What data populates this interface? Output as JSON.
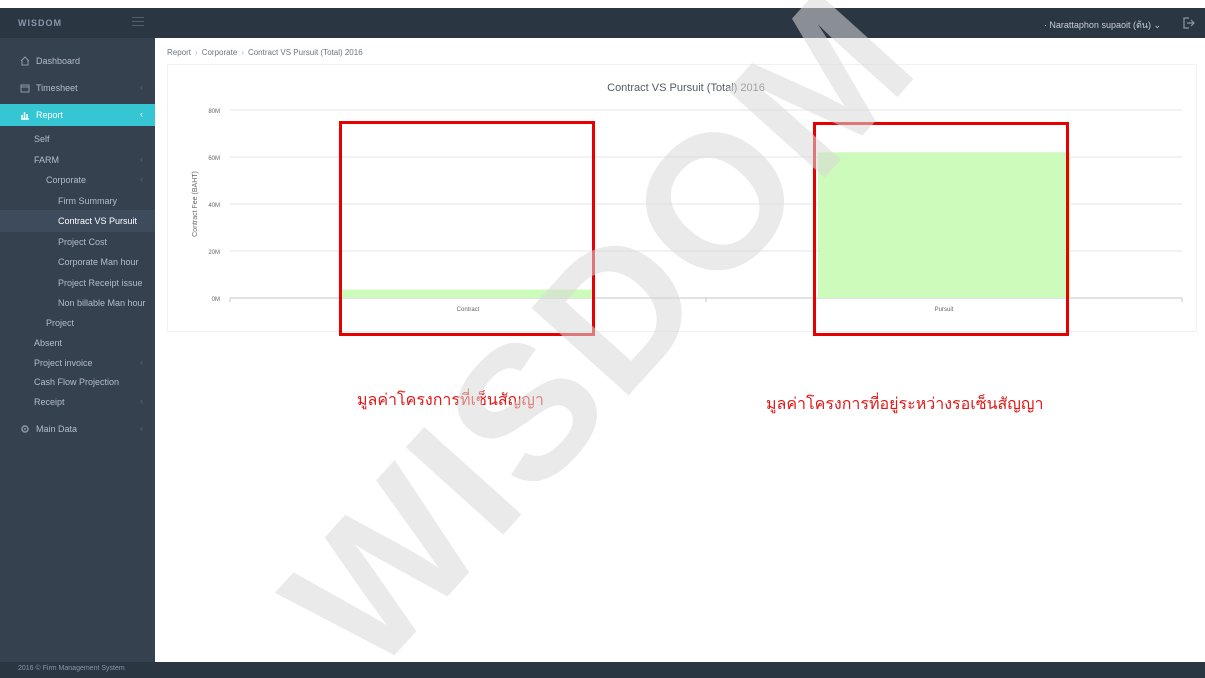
{
  "app": {
    "logo": "WISDOM",
    "user_menu": "· Narattaphon supaoit (ต้น) ⌄",
    "footer": "2016 © Firm Management System"
  },
  "breadcrumb": [
    "Report",
    "Corporate",
    "Contract VS Pursuit (Total) 2016"
  ],
  "sidebar": {
    "items": [
      {
        "label": "Dashboard",
        "icon": "home-icon",
        "arrow": ""
      },
      {
        "label": "Timesheet",
        "icon": "calendar-icon",
        "arrow": "‹"
      },
      {
        "label": "Report",
        "icon": "bar-chart-icon",
        "arrow": "‹"
      },
      {
        "label": "Self",
        "arrow": ""
      },
      {
        "label": "FARM",
        "arrow": "‹"
      },
      {
        "label": "Corporate",
        "arrow": "‹"
      },
      {
        "label": "Firm Summary",
        "arrow": ""
      },
      {
        "label": "Contract VS Pursuit",
        "arrow": ""
      },
      {
        "label": "Project Cost",
        "arrow": ""
      },
      {
        "label": "Corporate Man hour",
        "arrow": ""
      },
      {
        "label": "Project Receipt issue",
        "arrow": ""
      },
      {
        "label": "Non billable Man hour",
        "arrow": ""
      },
      {
        "label": "Project",
        "arrow": ""
      },
      {
        "label": "Absent",
        "arrow": ""
      },
      {
        "label": "Project invoice",
        "arrow": "‹"
      },
      {
        "label": "Cash Flow Projection",
        "arrow": ""
      },
      {
        "label": "Receipt",
        "arrow": "‹"
      },
      {
        "label": "Main Data",
        "icon": "settings-icon",
        "arrow": "‹"
      }
    ]
  },
  "chart_data": {
    "type": "bar",
    "title": "Contract VS Pursuit (Total) 2016",
    "categories": [
      "Contract",
      "Pursuit"
    ],
    "values": [
      3600000,
      62000000
    ],
    "ylabel": "Contract Fee (BAHT)",
    "xlabel": "",
    "ylim": [
      0,
      80000000
    ],
    "yticks": [
      0,
      20000000,
      40000000,
      60000000,
      80000000
    ],
    "ytick_labels": [
      "0M",
      "20M",
      "40M",
      "60M",
      "80M"
    ],
    "grid": true,
    "bar_color": "#ccfbbb"
  },
  "annotations": {
    "contract_caption": "มูลค่าโครงการที่เซ็นสัญญา",
    "pursuit_caption": "มูลค่าโครงการที่อยู่ระหว่างรอเซ็นสัญญา",
    "box_color": "#e60000"
  },
  "watermark": "WISDOM"
}
